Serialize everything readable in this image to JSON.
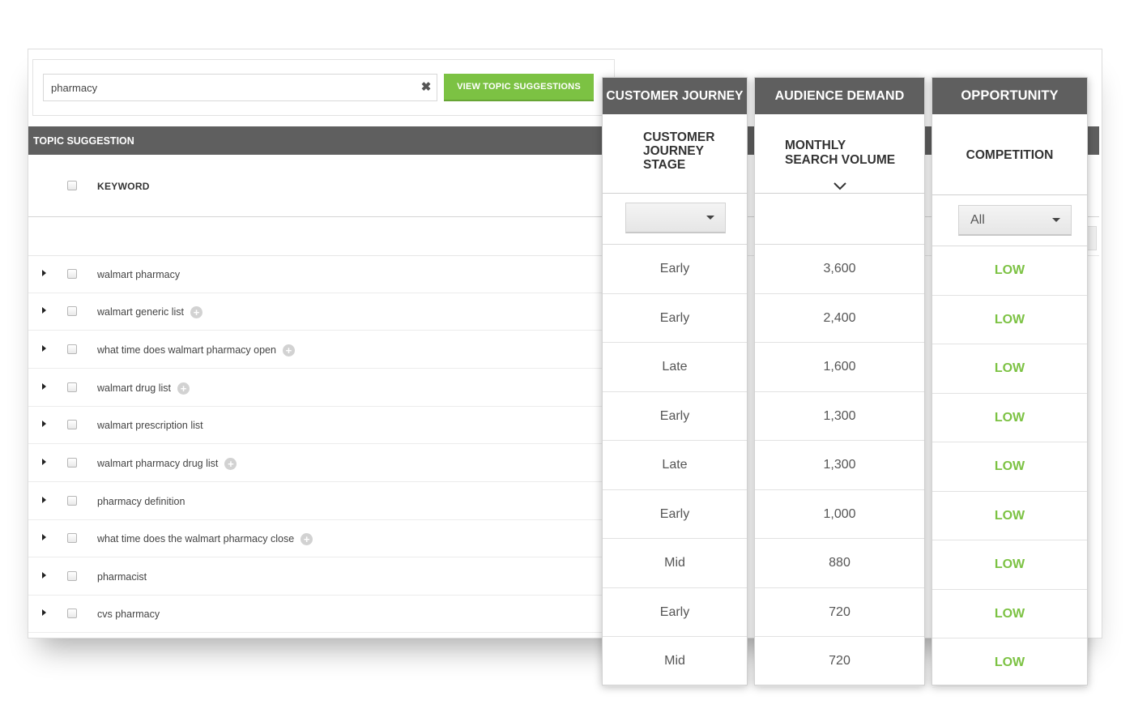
{
  "search": {
    "value": "pharmacy",
    "clear_glyph": "✖",
    "button_label": "VIEW TOPIC SUGGESTIONS"
  },
  "table": {
    "section_title": "TOPIC SUGGESTION",
    "keyword_header": "KEYWORD",
    "rows": [
      {
        "keyword": "walmart pharmacy",
        "has_add": false
      },
      {
        "keyword": "walmart generic list",
        "has_add": true
      },
      {
        "keyword": "what time does walmart pharmacy open",
        "has_add": true
      },
      {
        "keyword": "walmart drug list",
        "has_add": true
      },
      {
        "keyword": "walmart prescription list",
        "has_add": false
      },
      {
        "keyword": "walmart pharmacy drug list",
        "has_add": true
      },
      {
        "keyword": "pharmacy definition",
        "has_add": false
      },
      {
        "keyword": "what time does the walmart pharmacy close",
        "has_add": true
      },
      {
        "keyword": "pharmacist",
        "has_add": false
      },
      {
        "keyword": "cvs pharmacy",
        "has_add": false
      }
    ]
  },
  "columns": {
    "journey": {
      "header": "CUSTOMER JOURNEY",
      "sub_lines": [
        "CUSTOMER",
        "JOURNEY",
        "STAGE"
      ],
      "filter_value": "",
      "values": [
        "Early",
        "Early",
        "Late",
        "Early",
        "Late",
        "Early",
        "Mid",
        "Early",
        "Mid"
      ]
    },
    "demand": {
      "header": "AUDIENCE DEMAND",
      "sub_lines": [
        "MONTHLY",
        "SEARCH VOLUME"
      ],
      "sort_icon": "chevron-down-icon",
      "values": [
        "3,600",
        "2,400",
        "1,600",
        "1,300",
        "1,300",
        "1,000",
        "880",
        "720",
        "720"
      ]
    },
    "opportunity": {
      "header": "OPPORTUNITY",
      "sub_lines": [
        "COMPETITION"
      ],
      "filter_value": "All",
      "values": [
        "LOW",
        "LOW",
        "LOW",
        "LOW",
        "LOW",
        "LOW",
        "LOW",
        "LOW",
        "LOW"
      ]
    }
  },
  "colors": {
    "accent_green": "#7cc243",
    "header_gray": "#5f5f5f"
  }
}
